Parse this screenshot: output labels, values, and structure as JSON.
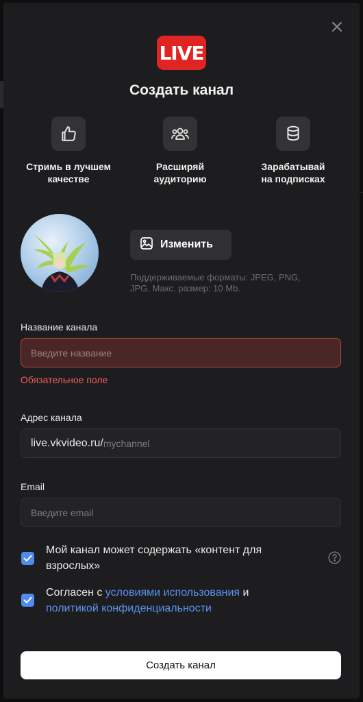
{
  "colors": {
    "accent": "#4f8bf0",
    "error": "#f05c5c",
    "brand": "#e02424",
    "modal_bg": "#1d1d1f"
  },
  "header": {
    "logo_text": "LIVE",
    "title": "Создать канал"
  },
  "features": [
    {
      "icon": "thumbs-up-icon",
      "line1": "Стримь в лучшем",
      "line2": "качестве"
    },
    {
      "icon": "audience-icon",
      "line1": "Расширяй",
      "line2": "аудиторию"
    },
    {
      "icon": "coins-icon",
      "line1": "Зарабатывай",
      "line2": "на подписках"
    }
  ],
  "avatar": {
    "change_label": "Изменить",
    "formats_line1": "Поддерживаемые форматы: JPEG, PNG,",
    "formats_line2": "JPG. Макс. размер: 10 Mb."
  },
  "form": {
    "name_label": "Название канала",
    "name_placeholder": "Введите название",
    "name_error": "Обязательное поле",
    "address_label": "Адрес канала",
    "address_prefix": "live.vkvideo.ru/",
    "address_placeholder": "mychannel",
    "email_label": "Email",
    "email_placeholder": "Введите email"
  },
  "checks": {
    "adult_line1": "Мой канал может содержать «контент для",
    "adult_line2": "взрослых»",
    "adult_checked": true,
    "terms_prefix": "Согласен с ",
    "terms_link": "условиями использования",
    "terms_and": " и",
    "privacy_link": "политикой конфиденциальности",
    "terms_checked": true
  },
  "submit_label": "Создать канал"
}
